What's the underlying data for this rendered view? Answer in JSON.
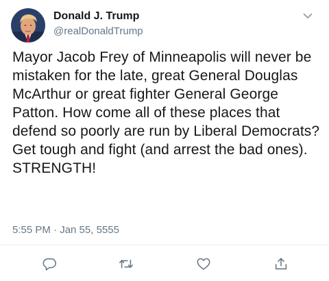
{
  "author": {
    "name": "Donald J. Trump",
    "handle": "@realDonaldTrump",
    "avatar": "profile-avatar"
  },
  "tweet": {
    "text": "Mayor Jacob Frey of Minneapolis will never be mistaken for the late, great General Douglas McArthur or great fighter General George Patton. How come all of these places that defend so poorly are run by Liberal Democrats? Get tough and fight (and arrest the bad ones). STRENGTH!",
    "timestamp": "5:55 PM · Jan 55, 5555"
  },
  "actions": {
    "reply_icon": "reply-icon",
    "retweet_icon": "retweet-icon",
    "like_icon": "like-icon",
    "share_icon": "share-icon"
  },
  "colors": {
    "text": "#14171a",
    "secondary": "#657786",
    "divider": "#e6ecf0"
  }
}
